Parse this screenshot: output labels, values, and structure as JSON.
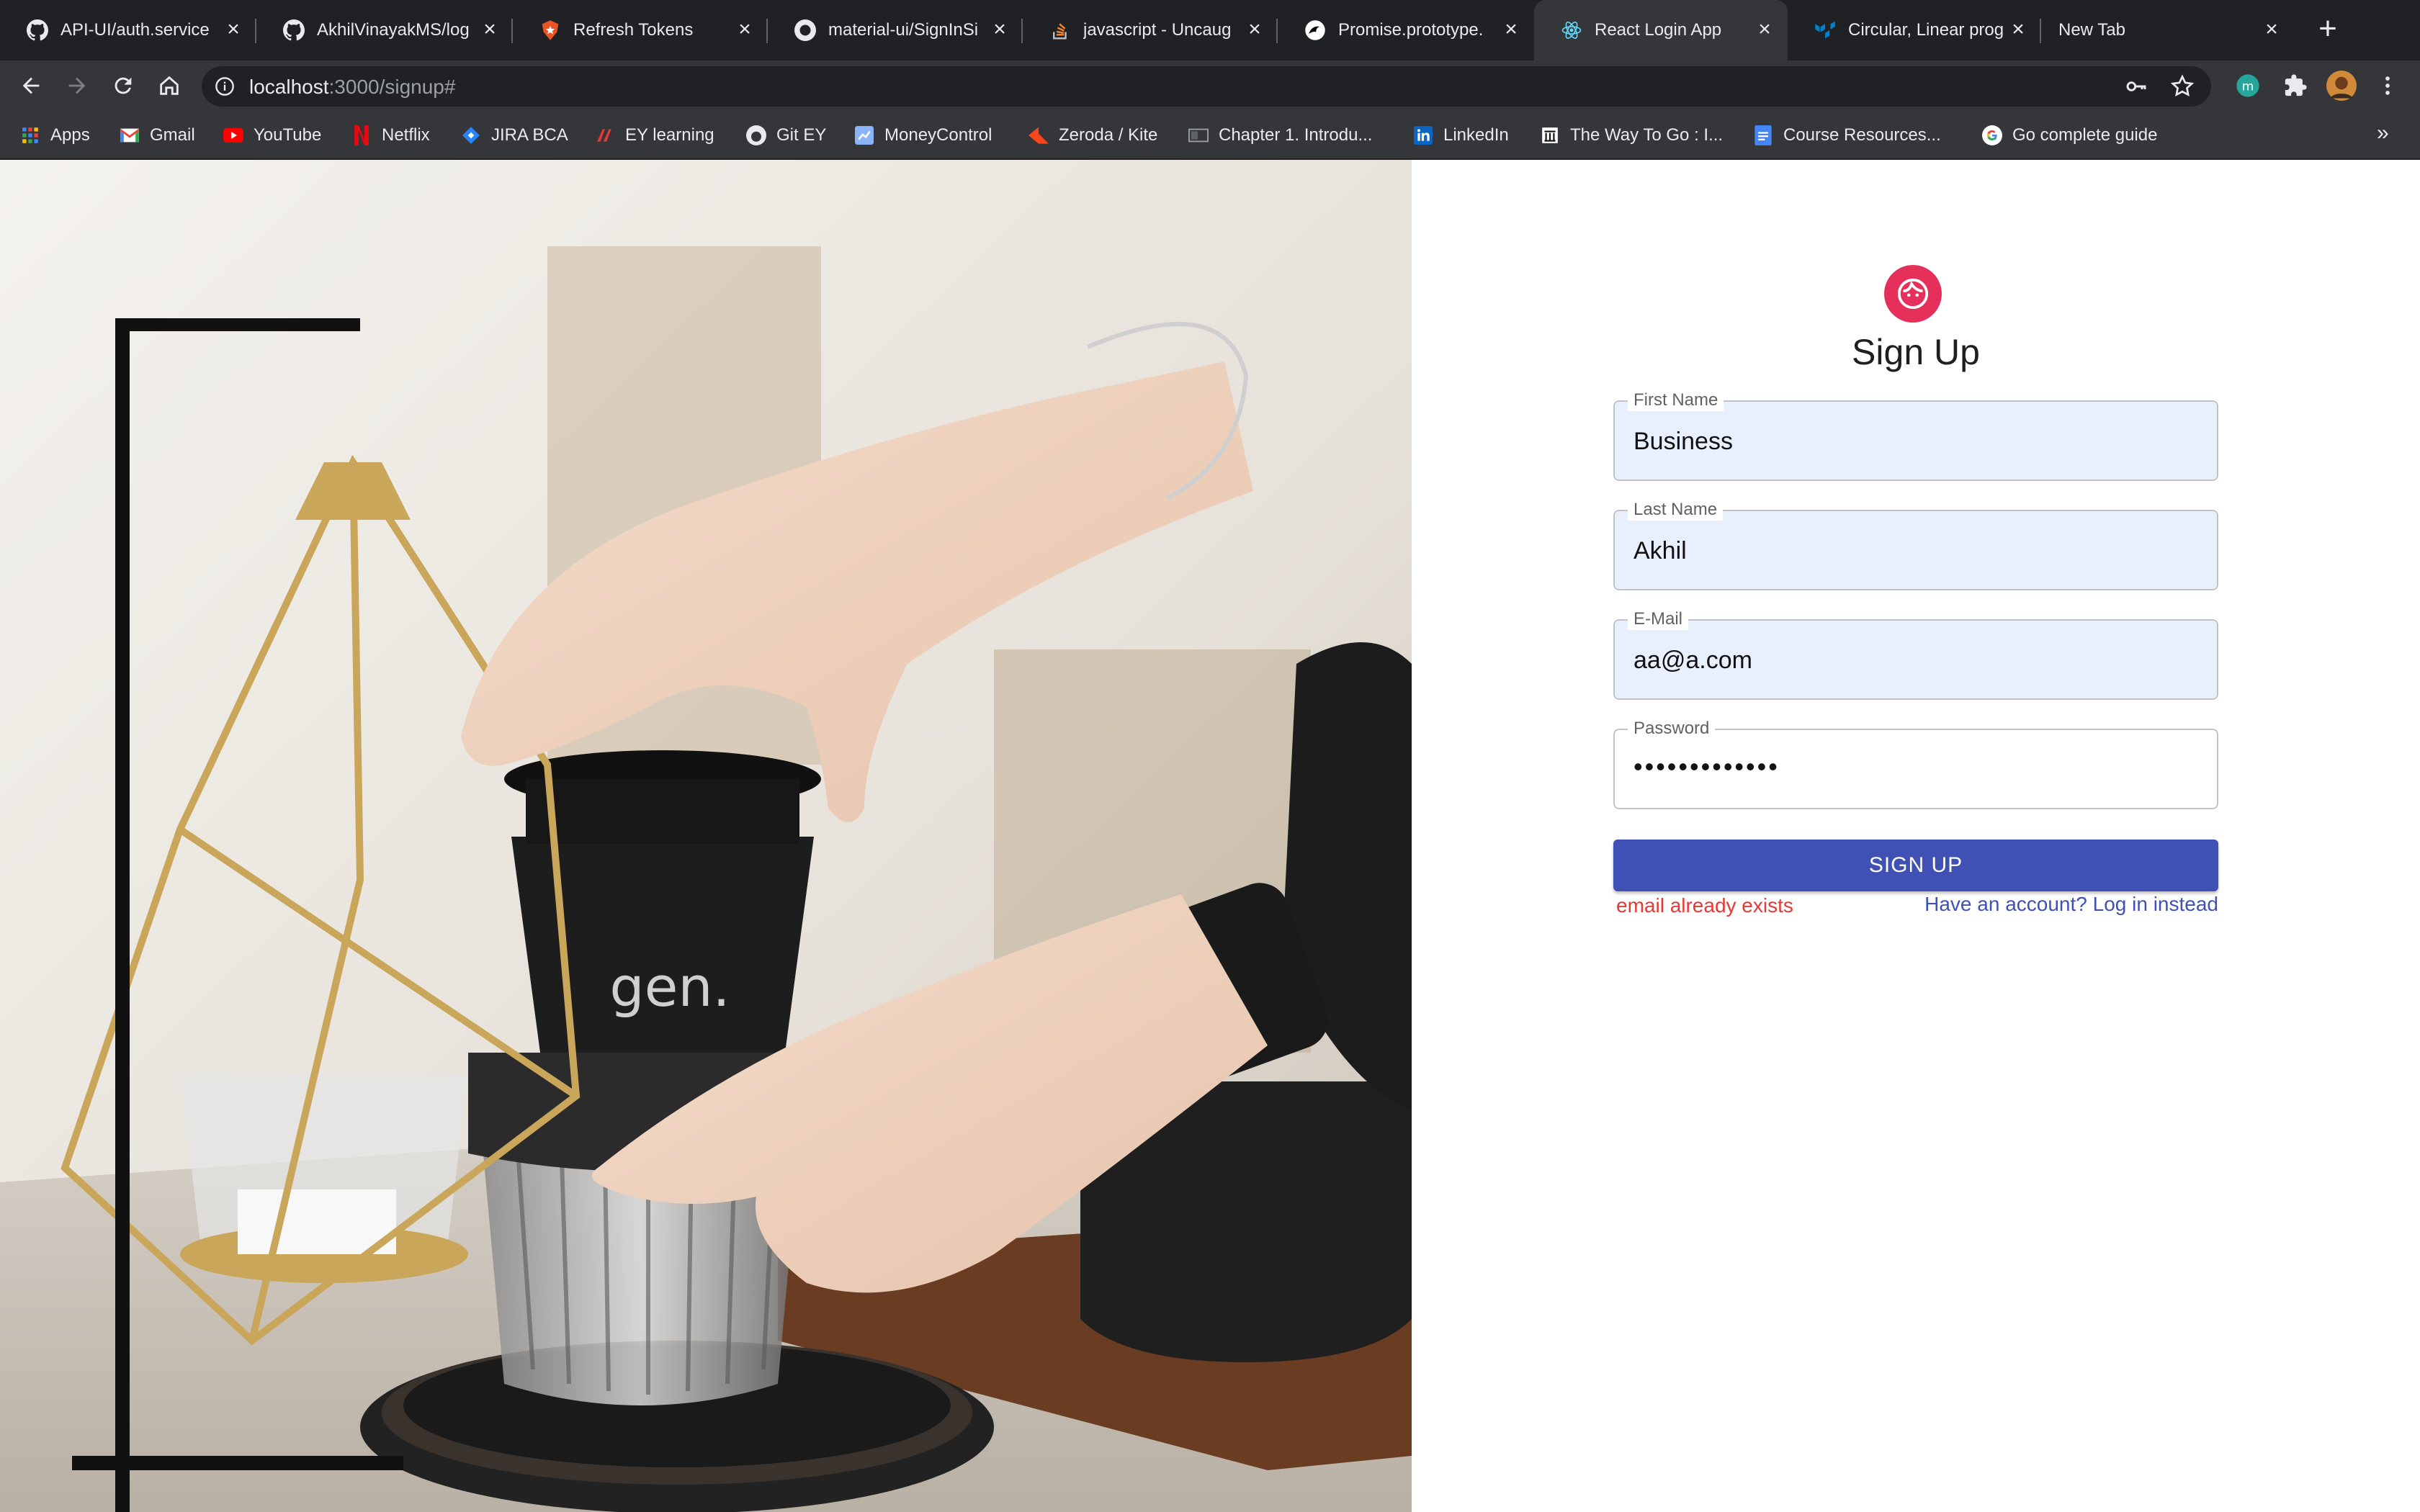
{
  "browser": {
    "tabs": [
      {
        "title": "API-UI/auth.service",
        "icon": "github-icon"
      },
      {
        "title": "AkhilVinayakMS/log",
        "icon": "github-icon"
      },
      {
        "title": "Refresh Tokens",
        "icon": "auth0-icon"
      },
      {
        "title": "material-ui/SignInSi",
        "icon": "github-icon"
      },
      {
        "title": "javascript - Uncaug",
        "icon": "stackoverflow-icon"
      },
      {
        "title": "Promise.prototype.",
        "icon": "mdn-icon"
      },
      {
        "title": "React Login App",
        "icon": "react-icon",
        "active": true
      },
      {
        "title": "Circular, Linear prog",
        "icon": "material-ui-icon"
      },
      {
        "title": "New Tab",
        "icon": ""
      }
    ],
    "url_host": "localhost",
    "url_rest": ":3000/signup#",
    "bookmarks": [
      {
        "label": "Apps",
        "icon": "apps-grid-icon"
      },
      {
        "label": "Gmail",
        "icon": "gmail-icon"
      },
      {
        "label": "YouTube",
        "icon": "youtube-icon"
      },
      {
        "label": "Netflix",
        "icon": "netflix-icon"
      },
      {
        "label": "JIRA BCA",
        "icon": "jira-icon"
      },
      {
        "label": "EY learning",
        "icon": "ey-icon"
      },
      {
        "label": "Git EY",
        "icon": "github-icon"
      },
      {
        "label": "MoneyControl",
        "icon": "moneycontrol-icon"
      },
      {
        "label": "Zeroda / Kite",
        "icon": "kite-icon"
      },
      {
        "label": "Chapter 1. Introdu...",
        "icon": "book-icon"
      },
      {
        "label": "LinkedIn",
        "icon": "linkedin-icon"
      },
      {
        "label": "The Way To Go : I...",
        "icon": "library-icon"
      },
      {
        "label": "Course Resources...",
        "icon": "docs-icon"
      },
      {
        "label": "Go complete guide",
        "icon": "google-icon"
      }
    ],
    "more_bookmarks": "»",
    "colors": {
      "chrome_dark": "#202124",
      "chrome_toolbar": "#35363a"
    }
  },
  "signup": {
    "heading": "Sign Up",
    "first_name": {
      "label": "First Name",
      "value": "Business"
    },
    "last_name": {
      "label": "Last Name",
      "value": "Akhil"
    },
    "email": {
      "label": "E-Mail",
      "value": "aa@a.com"
    },
    "password": {
      "label": "Password",
      "value": "•••••••••••••"
    },
    "submit_label": "SIGN UP",
    "error": "email already exists",
    "login_link": "Have an account? Log in instead",
    "colors": {
      "primary": "#3f51b5",
      "avatar": "#e6305c",
      "error": "#e53935",
      "autofill": "#e8f0fe"
    }
  }
}
